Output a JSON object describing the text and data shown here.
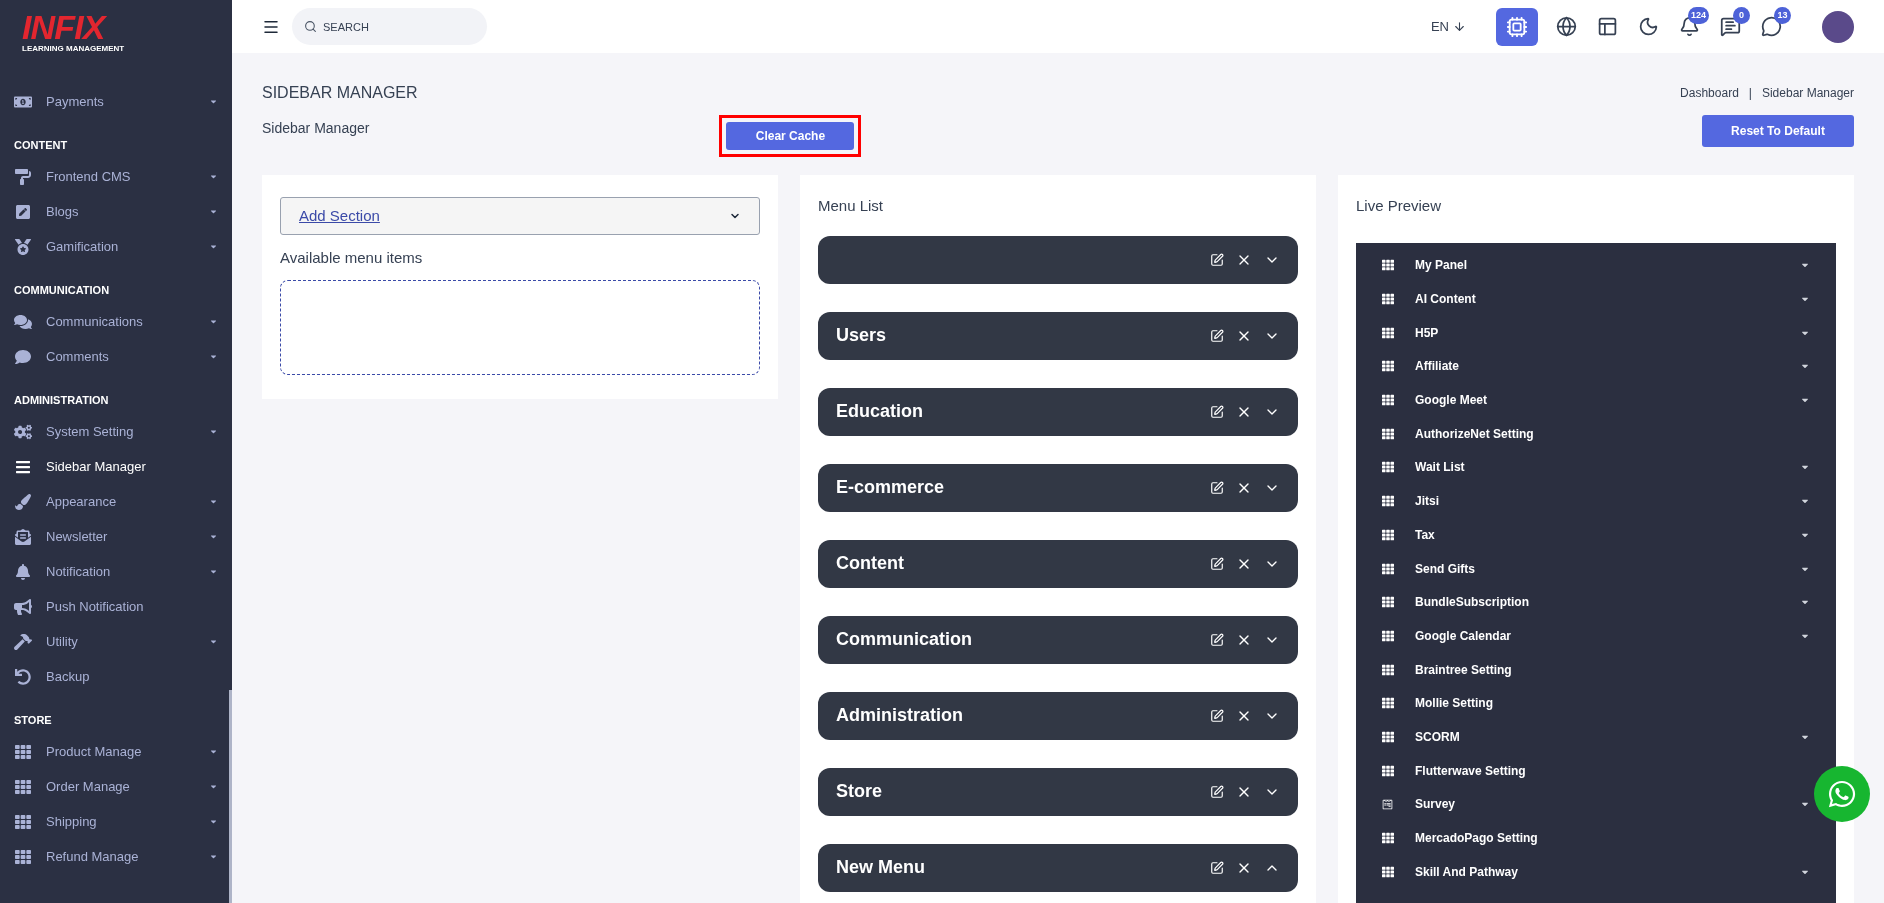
{
  "logo": {
    "brand": "INFIX",
    "tagline": "LEARNING MANAGEMENT"
  },
  "sidebar": {
    "groups": [
      {
        "items": [
          {
            "label": "Payments",
            "caret": true,
            "selected": false
          }
        ]
      },
      {
        "heading": "CONTENT",
        "items": [
          {
            "label": "Frontend CMS",
            "caret": true,
            "selected": false
          },
          {
            "label": "Blogs",
            "caret": true,
            "selected": false
          },
          {
            "label": "Gamification",
            "caret": true,
            "selected": false
          }
        ]
      },
      {
        "heading": "COMMUNICATION",
        "items": [
          {
            "label": "Communications",
            "caret": true,
            "selected": false
          },
          {
            "label": "Comments",
            "caret": true,
            "selected": false
          }
        ]
      },
      {
        "heading": "ADMINISTRATION",
        "items": [
          {
            "label": "System Setting",
            "caret": true,
            "selected": false
          },
          {
            "label": "Sidebar Manager",
            "caret": false,
            "selected": true
          },
          {
            "label": "Appearance",
            "caret": true,
            "selected": false
          },
          {
            "label": "Newsletter",
            "caret": true,
            "selected": false
          },
          {
            "label": "Notification",
            "caret": true,
            "selected": false
          },
          {
            "label": "Push Notification",
            "caret": false,
            "selected": false
          },
          {
            "label": "Utility",
            "caret": true,
            "selected": false
          },
          {
            "label": "Backup",
            "caret": false,
            "selected": false
          }
        ]
      },
      {
        "heading": "STORE",
        "items": [
          {
            "label": "Product Manage",
            "caret": true,
            "selected": false
          },
          {
            "label": "Order Manage",
            "caret": true,
            "selected": false
          },
          {
            "label": "Shipping",
            "caret": true,
            "selected": false
          },
          {
            "label": "Refund Manage",
            "caret": true,
            "selected": false
          }
        ]
      }
    ]
  },
  "topbar": {
    "search": {
      "placeholder": "SEARCH"
    },
    "language": "EN",
    "badges": {
      "notifications": "124",
      "messages": "0",
      "chats": "13"
    }
  },
  "page": {
    "title": "SIDEBAR MANAGER",
    "subtitle": "Sidebar Manager",
    "breadcrumb": [
      "Dashboard",
      "Sidebar Manager"
    ],
    "breadcrumb_separator": "|",
    "clear_cache": "Clear Cache",
    "reset": "Reset To Default"
  },
  "left_card": {
    "select": "Add Section",
    "available_label": "Available menu items"
  },
  "menu_list": {
    "title": "Menu List",
    "sections": [
      {
        "expanded": false
      },
      {
        "title": "Users",
        "expanded": false
      },
      {
        "title": "Education",
        "expanded": false
      },
      {
        "title": "E-commerce",
        "expanded": false
      },
      {
        "title": "Content",
        "expanded": false
      },
      {
        "title": "Communication",
        "expanded": false
      },
      {
        "title": "Administration",
        "expanded": false
      },
      {
        "title": "Store",
        "expanded": false
      },
      {
        "title": "New Menu",
        "expanded": true
      }
    ]
  },
  "live_preview": {
    "title": "Live Preview",
    "items": [
      {
        "label": "My Panel",
        "kind": "grid",
        "caret": true
      },
      {
        "label": "AI Content",
        "kind": "grid",
        "caret": true
      },
      {
        "label": "H5P",
        "kind": "grid",
        "caret": true
      },
      {
        "label": "Affiliate",
        "kind": "grid",
        "caret": true
      },
      {
        "label": "Google Meet",
        "kind": "grid",
        "caret": true
      },
      {
        "label": "AuthorizeNet Setting",
        "kind": "grid",
        "caret": false
      },
      {
        "label": "Wait List",
        "kind": "grid",
        "caret": true
      },
      {
        "label": "Jitsi",
        "kind": "grid",
        "caret": true
      },
      {
        "label": "Tax",
        "kind": "grid",
        "caret": true
      },
      {
        "label": "Send Gifts",
        "kind": "grid",
        "caret": true
      },
      {
        "label": "BundleSubscription",
        "kind": "grid",
        "caret": true
      },
      {
        "label": "Google Calendar",
        "kind": "grid",
        "caret": true
      },
      {
        "label": "Braintree Setting",
        "kind": "grid",
        "caret": false
      },
      {
        "label": "Mollie Setting",
        "kind": "grid",
        "caret": false
      },
      {
        "label": "SCORM",
        "kind": "grid",
        "caret": true
      },
      {
        "label": "Flutterwave Setting",
        "kind": "grid",
        "caret": false
      },
      {
        "label": "Survey",
        "kind": "form",
        "caret": true
      },
      {
        "label": "MercadoPago Setting",
        "kind": "grid",
        "caret": false
      },
      {
        "label": "Skill And Pathway",
        "kind": "grid",
        "caret": true
      }
    ]
  }
}
